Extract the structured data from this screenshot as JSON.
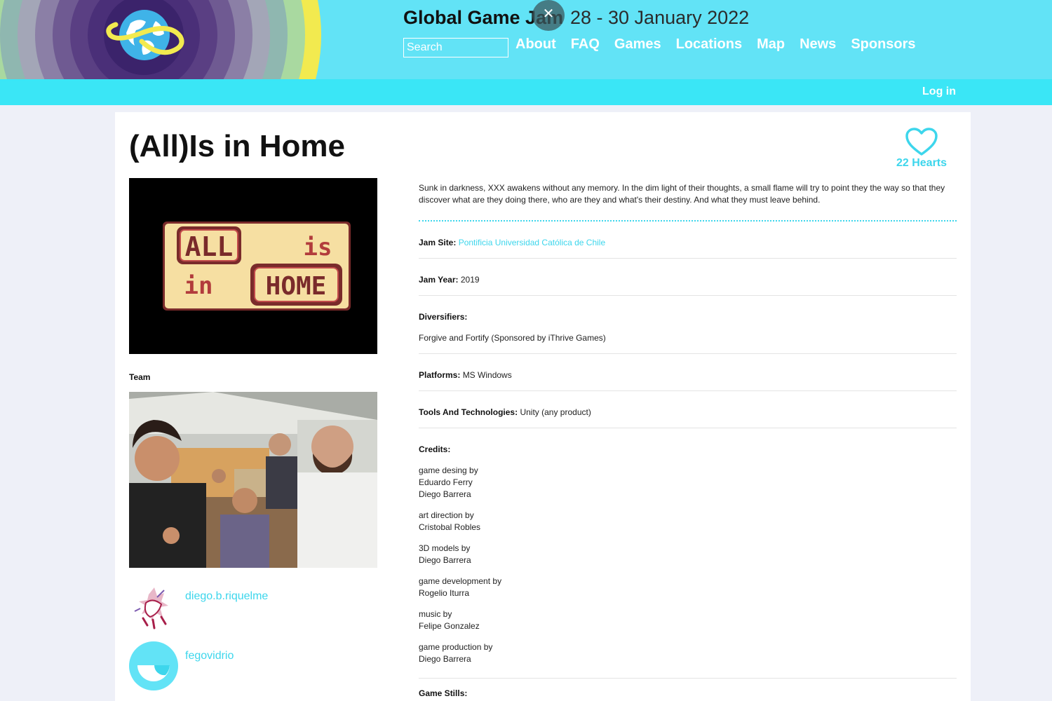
{
  "header": {
    "site_title": "Global Game Jam",
    "dates": "28 - 30 January 2022",
    "search_placeholder": "Search",
    "nav": [
      "About",
      "FAQ",
      "Games",
      "Locations",
      "Map",
      "News",
      "Sponsors"
    ],
    "login": "Log in",
    "close_glyph": "✕"
  },
  "colors": {
    "header_bg": "#62e3f6",
    "subbar_bg": "#3ae6f6",
    "accent": "#3dd6ec",
    "page_bg": "#eef0f8"
  },
  "game": {
    "title": "(All)Is in Home",
    "hearts": "22 Hearts",
    "cover_text": {
      "all": "ALL",
      "is": "is",
      "in": "in",
      "home": "HOME"
    },
    "team_label": "Team",
    "members": [
      {
        "name": "diego.b.riquelme"
      },
      {
        "name": "fegovidrio"
      }
    ],
    "description": "Sunk in darkness, XXX awakens without any memory. In the dim light of their thoughts, a small flame will try to point they the way so that they discover what are they doing there, who are they and what's their destiny. And what they must leave behind.",
    "jam_site_label": "Jam Site:",
    "jam_site": "Pontificia Universidad Católica de Chile",
    "jam_year_label": "Jam Year:",
    "jam_year": "2019",
    "diversifiers_label": "Diversifiers:",
    "diversifiers": "Forgive and Fortify (Sponsored by iThrive Games)",
    "platforms_label": "Platforms:",
    "platforms": "MS Windows",
    "tools_label": "Tools And Technologies:",
    "tools": "Unity (any product)",
    "credits_label": "Credits:",
    "credits": [
      {
        "role": "game desing by",
        "names": [
          "Eduardo Ferry",
          "Diego Barrera"
        ]
      },
      {
        "role": "art direction by",
        "names": [
          "Cristobal Robles"
        ]
      },
      {
        "role": "3D models by",
        "names": [
          "Diego Barrera"
        ]
      },
      {
        "role": "game development by",
        "names": [
          "Rogelio Iturra"
        ]
      },
      {
        "role": "music by",
        "names": [
          "Felipe Gonzalez"
        ]
      },
      {
        "role": "game production by",
        "names": [
          "Diego Barrera"
        ]
      }
    ],
    "stills_label": "Game Stills:"
  }
}
